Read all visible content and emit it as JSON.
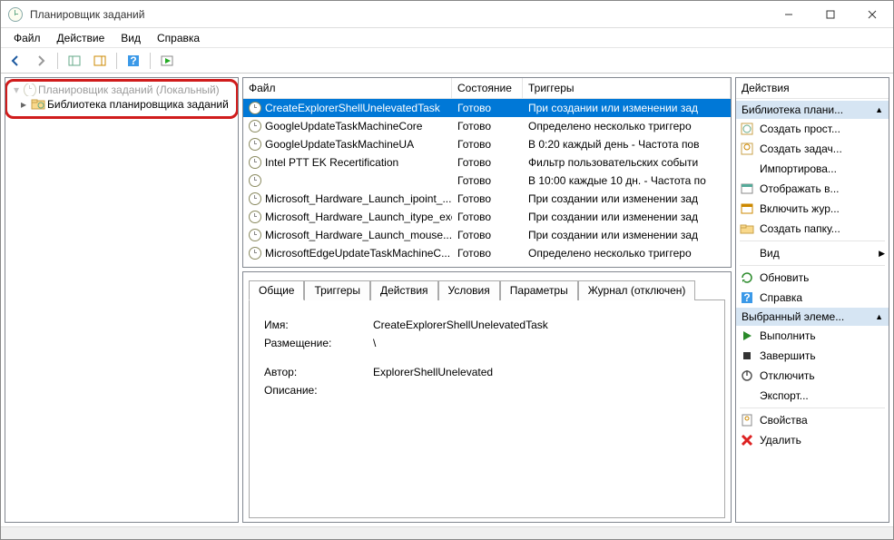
{
  "title": "Планировщик заданий",
  "menu": {
    "file": "Файл",
    "action": "Действие",
    "view": "Вид",
    "help": "Справка"
  },
  "tree": {
    "root": "Планировщик заданий (Локальный)",
    "lib": "Библиотека планировщика заданий"
  },
  "columns": {
    "file": "Файл",
    "state": "Состояние",
    "triggers": "Триггеры"
  },
  "tasks": [
    {
      "name": "CreateExplorerShellUnelevatedTask",
      "state": "Готово",
      "trigger": "При создании или изменении зад"
    },
    {
      "name": "GoogleUpdateTaskMachineCore",
      "state": "Готово",
      "trigger": "Определено несколько триггеро"
    },
    {
      "name": "GoogleUpdateTaskMachineUA",
      "state": "Готово",
      "trigger": "В 0:20 каждый день - Частота пов"
    },
    {
      "name": "Intel PTT EK Recertification",
      "state": "Готово",
      "trigger": "Фильтр пользовательских событи"
    },
    {
      "name": "",
      "state": "Готово",
      "trigger": "В 10:00 каждые 10 дн. - Частота по"
    },
    {
      "name": "Microsoft_Hardware_Launch_ipoint_...",
      "state": "Готово",
      "trigger": "При создании или изменении зад"
    },
    {
      "name": "Microsoft_Hardware_Launch_itype_exe",
      "state": "Готово",
      "trigger": "При создании или изменении зад"
    },
    {
      "name": "Microsoft_Hardware_Launch_mouse...",
      "state": "Готово",
      "trigger": "При создании или изменении зад"
    },
    {
      "name": "MicrosoftEdgeUpdateTaskMachineC...",
      "state": "Готово",
      "trigger": "Определено несколько триггеро"
    }
  ],
  "tabs": {
    "general": "Общие",
    "triggers": "Триггеры",
    "actions": "Действия",
    "conditions": "Условия",
    "settings": "Параметры",
    "history": "Журнал (отключен)"
  },
  "general": {
    "name_lbl": "Имя:",
    "name_val": "CreateExplorerShellUnelevatedTask",
    "loc_lbl": "Размещение:",
    "loc_val": "\\",
    "author_lbl": "Автор:",
    "author_val": "ExplorerShellUnelevated",
    "desc_lbl": "Описание:"
  },
  "actions": {
    "header": "Действия",
    "section1": "Библиотека плани...",
    "section2": "Выбранный элеме...",
    "create_basic": "Создать прост...",
    "create": "Создать задач...",
    "import": "Импортирова...",
    "show_running": "Отображать в...",
    "enable_history": "Включить жур...",
    "new_folder": "Создать папку...",
    "view": "Вид",
    "refresh": "Обновить",
    "help": "Справка",
    "run": "Выполнить",
    "end": "Завершить",
    "disable": "Отключить",
    "export": "Экспорт...",
    "props": "Свойства",
    "delete": "Удалить"
  }
}
